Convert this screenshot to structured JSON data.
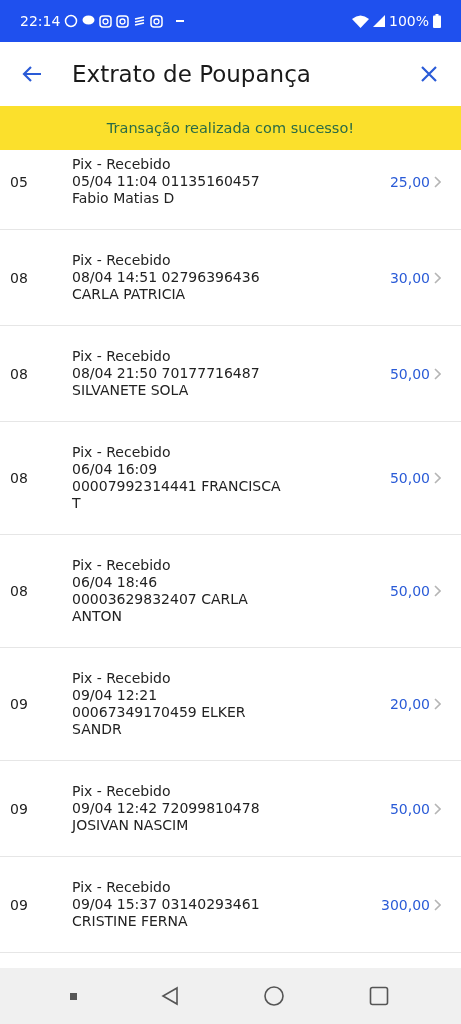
{
  "status_bar": {
    "time": "22:14",
    "battery": "100%"
  },
  "header": {
    "title": "Extrato de Poupança"
  },
  "banner": {
    "text": "Transação realizada com sucesso!"
  },
  "transactions": [
    {
      "day": "05",
      "lines": [
        "Pix - Recebido",
        "05/04 11:04 01135160457",
        "Fabio Matias D"
      ],
      "amount": "25,00"
    },
    {
      "day": "08",
      "lines": [
        "Pix - Recebido",
        "08/04 14:51 02796396436",
        "CARLA PATRICIA"
      ],
      "amount": "30,00"
    },
    {
      "day": "08",
      "lines": [
        "Pix - Recebido",
        "08/04 21:50 70177716487",
        "SILVANETE SOLA"
      ],
      "amount": "50,00"
    },
    {
      "day": "08",
      "lines": [
        "Pix - Recebido",
        "06/04 16:09",
        "00007992314441 FRANCISCA",
        "T"
      ],
      "amount": "50,00"
    },
    {
      "day": "08",
      "lines": [
        "Pix - Recebido",
        "06/04 18:46",
        "00003629832407 CARLA",
        "ANTON"
      ],
      "amount": "50,00"
    },
    {
      "day": "09",
      "lines": [
        "Pix - Recebido",
        "09/04 12:21",
        "00067349170459 ELKER",
        "SANDR"
      ],
      "amount": "20,00"
    },
    {
      "day": "09",
      "lines": [
        "Pix - Recebido",
        "09/04 12:42 72099810478",
        "JOSIVAN NASCIM"
      ],
      "amount": "50,00"
    },
    {
      "day": "09",
      "lines": [
        "Pix - Recebido",
        "09/04 15:37 03140293461",
        "CRISTINE FERNA"
      ],
      "amount": "300,00"
    }
  ]
}
